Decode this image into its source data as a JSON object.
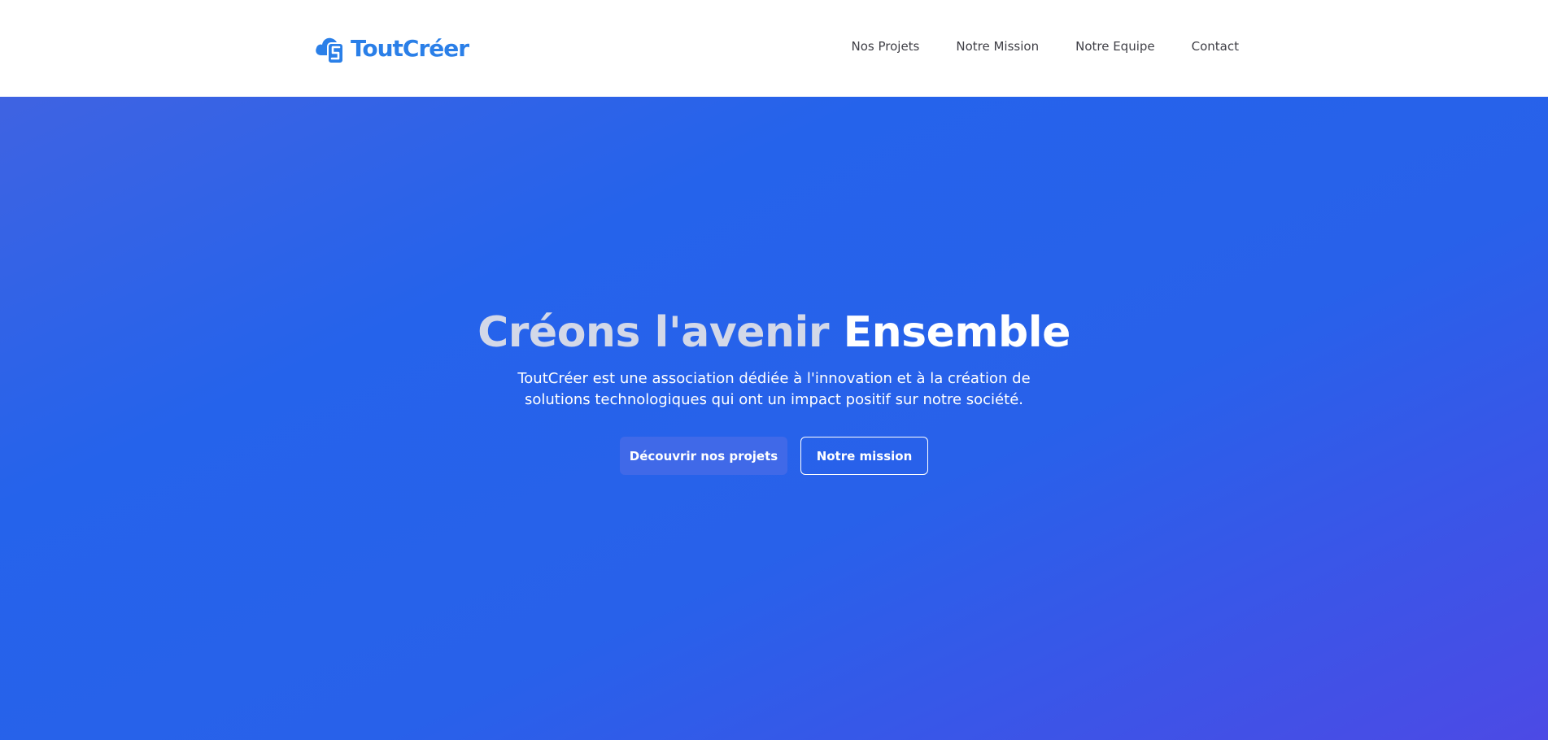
{
  "header": {
    "logo_text": "ToutCréer",
    "logo_icon": "cloud-s-icon",
    "nav": [
      "Nos Projets",
      "Notre Mission",
      "Notre Equipe",
      "Contact"
    ]
  },
  "hero": {
    "title_part1": "Créons l'avenir",
    "title_part2": "Ensemble",
    "subtitle": "ToutCréer est une association dédiée à l'innovation et à la création de solutions technologiques qui ont un impact positif sur notre société.",
    "primary_button": "Découvrir nos projets",
    "secondary_button": "Notre mission"
  },
  "colors": {
    "brand": "#2a7fe8",
    "hero_gradient_start": "#3f63e2",
    "hero_gradient_end": "#4c4ae5",
    "primary_button_bg": "#4069e8"
  }
}
